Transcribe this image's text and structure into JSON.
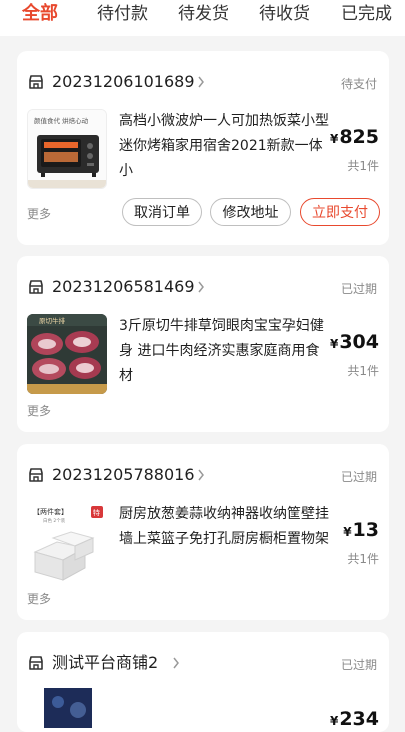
{
  "tabs": [
    "全部",
    "待付款",
    "待发货",
    "待收货",
    "已完成"
  ],
  "orders": [
    {
      "order_no": "20231206101689",
      "status": "待支付",
      "product_title": "高档小微波炉一人可加热饭菜小型迷你烤箱家用宿舍2021新款一体小",
      "thumb_text": "颜值食代 烘焙心动",
      "currency": "¥",
      "price": "825",
      "qty": "共1件",
      "more": "更多",
      "buttons": [
        "取消订单",
        "修改地址",
        "立即支付"
      ]
    },
    {
      "order_no": "20231206581469",
      "status": "已过期",
      "product_title": "3斤原切牛排草饲眼肉宝宝孕妇健身 进口牛肉经济实惠家庭商用食材",
      "thumb_text": "原切牛排",
      "currency": "¥",
      "price": "304",
      "qty": "共1件",
      "more": "更多"
    },
    {
      "order_no": "20231205788016",
      "status": "已过期",
      "product_title": "厨房放葱姜蒜收纳神器收纳筐壁挂墙上菜篮子免打孔厨房橱柜置物架",
      "thumb_text": "【两件套】",
      "thumb_sub": "白色 2个装",
      "thumb_badge": "特",
      "currency": "¥",
      "price": "13",
      "qty": "共1件",
      "more": "更多"
    },
    {
      "order_no": "测试平台商铺2",
      "status": "已过期",
      "currency": "¥",
      "price": "234"
    }
  ],
  "colors": {
    "accent": "#e8492e",
    "background": "#f4f4f4"
  }
}
